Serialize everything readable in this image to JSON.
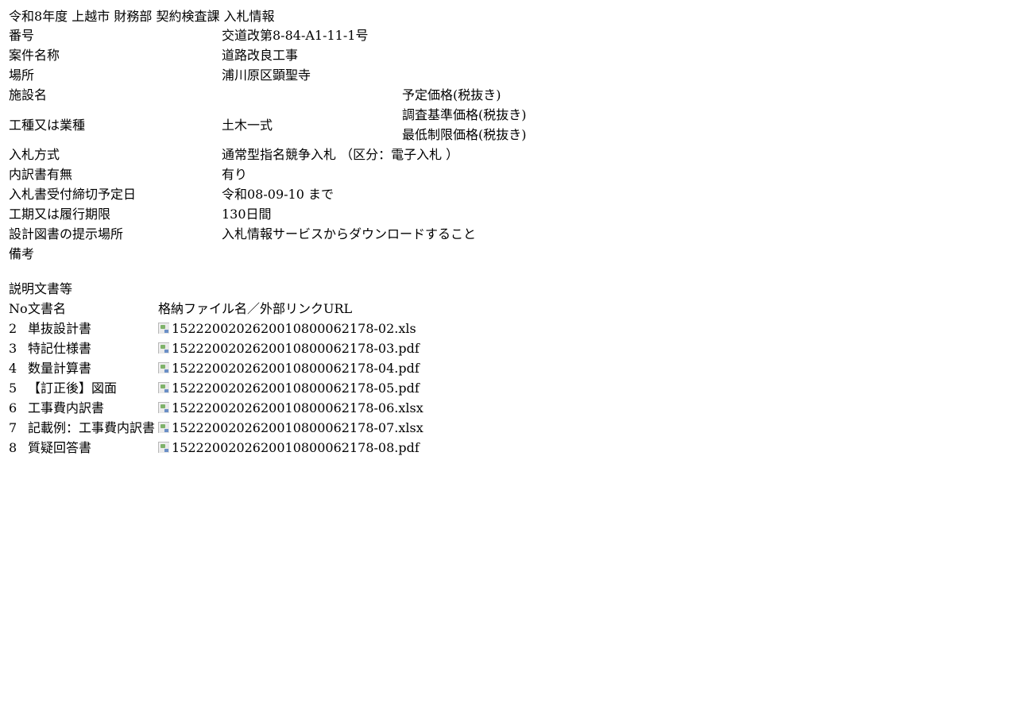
{
  "header": {
    "title": "令和8年度  上越市  財務部  契約検査課  入札情報"
  },
  "info": {
    "number": {
      "label": "番号",
      "value": "交道改第8-84-A1-11-1号"
    },
    "project_name": {
      "label": "案件名称",
      "value": "道路改良工事"
    },
    "location": {
      "label": "場所",
      "value": "浦川原区顕聖寺"
    },
    "facility": {
      "label": "施設名",
      "value": ""
    },
    "work_type": {
      "label": "工種又は業種",
      "value": "土木一式"
    },
    "prices": {
      "planned": "予定価格(税抜き)",
      "survey_base": "調査基準価格(税抜き)",
      "minimum_limit": "最低制限価格(税抜き)"
    },
    "bid_method": {
      "label": "入札方式",
      "value": "通常型指名競争入札 （区分：電子入札 ）"
    },
    "breakdown": {
      "label": "内訳書有無",
      "value": "有り"
    },
    "deadline": {
      "label": "入札書受付締切予定日",
      "value": "令和08-09-10  まで"
    },
    "period": {
      "label": "工期又は履行期限",
      "value": "130日間"
    },
    "drawings": {
      "label": "設計図書の提示場所",
      "value": "入札情報サービスからダウンロードすること"
    },
    "remarks": {
      "label": "備考",
      "value": ""
    }
  },
  "documents": {
    "section_title": "説明文書等",
    "columns": {
      "no": "No",
      "name": "文書名",
      "file": "格納ファイル名／外部リンクURL"
    },
    "rows": [
      {
        "no": "2",
        "name": "単抜設計書",
        "file": "15222002026200108000621​78-02.xls"
      },
      {
        "no": "3",
        "name": "特記仕様書",
        "file": "1522200202620010800062178-03.pdf"
      },
      {
        "no": "4",
        "name": "数量計算書",
        "file": "1522200202620010800062178-04.pdf"
      },
      {
        "no": "5",
        "name": "【訂正後】図面",
        "file": "1522200202620010800062178-05.pdf"
      },
      {
        "no": "6",
        "name": "工事費内訳書",
        "file": "1522200202620010800062178-06.xlsx"
      },
      {
        "no": "7",
        "name": "記載例：工事費内訳書",
        "file": "1522200202620010800062178-07.xlsx"
      },
      {
        "no": "8",
        "name": "質疑回答書",
        "file": "1522200202620010800062178-08.pdf"
      }
    ]
  }
}
